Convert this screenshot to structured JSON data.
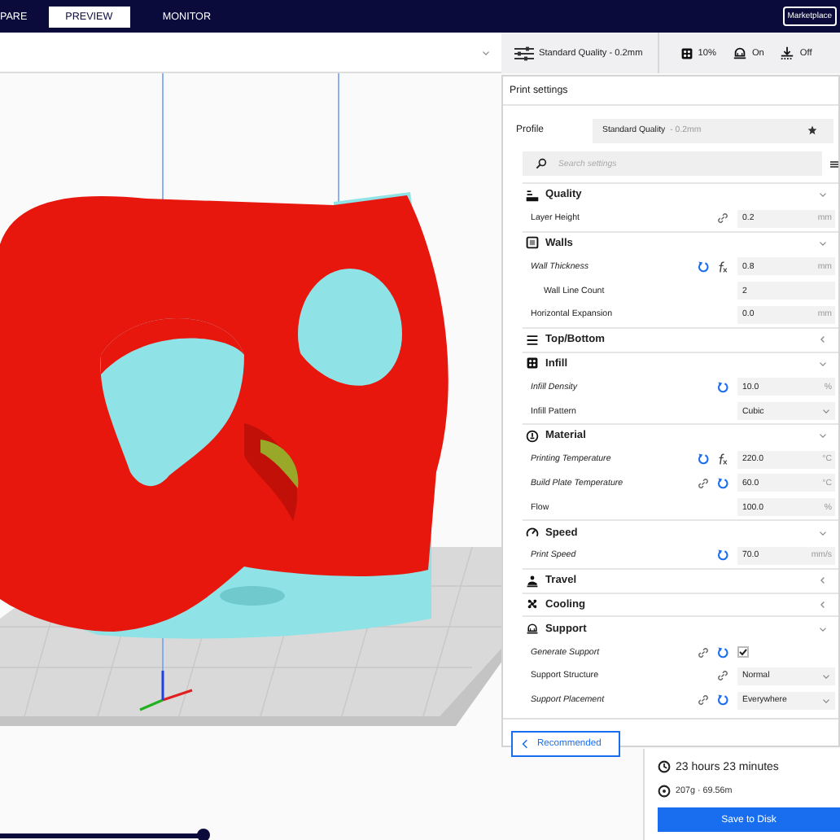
{
  "top_bar": {
    "tabs": [
      {
        "label": "PARE",
        "selected": false
      },
      {
        "label": "PREVIEW",
        "selected": true
      },
      {
        "label": "MONITOR",
        "selected": false
      }
    ],
    "marketplace_button": "Marketplace"
  },
  "print_setup_summary": {
    "profile": "Standard Quality - 0.2mm",
    "infill": "10%",
    "support": "On",
    "adhesion": "Off"
  },
  "print_settings": {
    "title": "Print settings",
    "profile_label": "Profile",
    "profile_name": "Standard Quality",
    "profile_detail": "- 0.2mm",
    "search": {
      "placeholder": "Search settings"
    },
    "sections": [
      {
        "title": "Quality",
        "expanded": true,
        "settings": [
          {
            "label": "Layer Height",
            "kind": "number",
            "value": "0.2",
            "unit": "mm",
            "changed": false,
            "linked": true,
            "formula": false
          }
        ]
      },
      {
        "title": "Walls",
        "expanded": true,
        "settings": [
          {
            "label": "Wall Thickness",
            "kind": "number",
            "value": "0.8",
            "unit": "mm",
            "changed": true,
            "linked": false,
            "formula": true,
            "children": [
              {
                "label": "Wall Line Count",
                "kind": "number",
                "value": "2",
                "changed": false,
                "linked": false,
                "formula": false
              }
            ]
          },
          {
            "label": "Horizontal Expansion",
            "kind": "number",
            "value": "0.0",
            "unit": "mm",
            "changed": false,
            "linked": false,
            "formula": false
          }
        ]
      },
      {
        "title": "Top/Bottom",
        "expanded": false
      },
      {
        "title": "Infill",
        "expanded": true,
        "settings": [
          {
            "label": "Infill Density",
            "kind": "number",
            "value": "10.0",
            "unit": "%",
            "changed": true,
            "linked": false,
            "formula": false
          },
          {
            "label": "Infill Pattern",
            "kind": "dropdown",
            "value": "Cubic",
            "changed": false,
            "linked": false,
            "formula": false
          }
        ]
      },
      {
        "title": "Material",
        "expanded": true,
        "settings": [
          {
            "label": "Printing Temperature",
            "kind": "number",
            "value": "220.0",
            "unit": "°C",
            "changed": true,
            "linked": false,
            "formula": true
          },
          {
            "label": "Build Plate Temperature",
            "kind": "number",
            "value": "60.0",
            "unit": "°C",
            "changed": true,
            "linked": true,
            "formula": false
          },
          {
            "label": "Flow",
            "kind": "number",
            "value": "100.0",
            "unit": "%",
            "changed": false,
            "linked": false,
            "formula": false
          }
        ]
      },
      {
        "title": "Speed",
        "expanded": true,
        "settings": [
          {
            "label": "Print Speed",
            "kind": "number",
            "value": "70.0",
            "unit": "mm/s",
            "changed": true,
            "linked": false,
            "formula": false
          }
        ]
      },
      {
        "title": "Travel",
        "expanded": false
      },
      {
        "title": "Cooling",
        "expanded": false
      },
      {
        "title": "Support",
        "expanded": true,
        "settings": [
          {
            "label": "Generate Support",
            "kind": "checkbox",
            "checked": true,
            "changed": true,
            "linked": true,
            "formula": false
          },
          {
            "label": "Support Structure",
            "kind": "dropdown",
            "value": "Normal",
            "changed": false,
            "linked": true,
            "formula": false
          },
          {
            "label": "Support Placement",
            "kind": "dropdown",
            "value": "Everywhere",
            "changed": true,
            "linked": true,
            "formula": false
          }
        ]
      }
    ],
    "recommended_button": "Recommended"
  },
  "estimate": {
    "time": "23 hours 23 minutes",
    "material": "207g · 69.56m",
    "save_button": "Save to Disk"
  }
}
